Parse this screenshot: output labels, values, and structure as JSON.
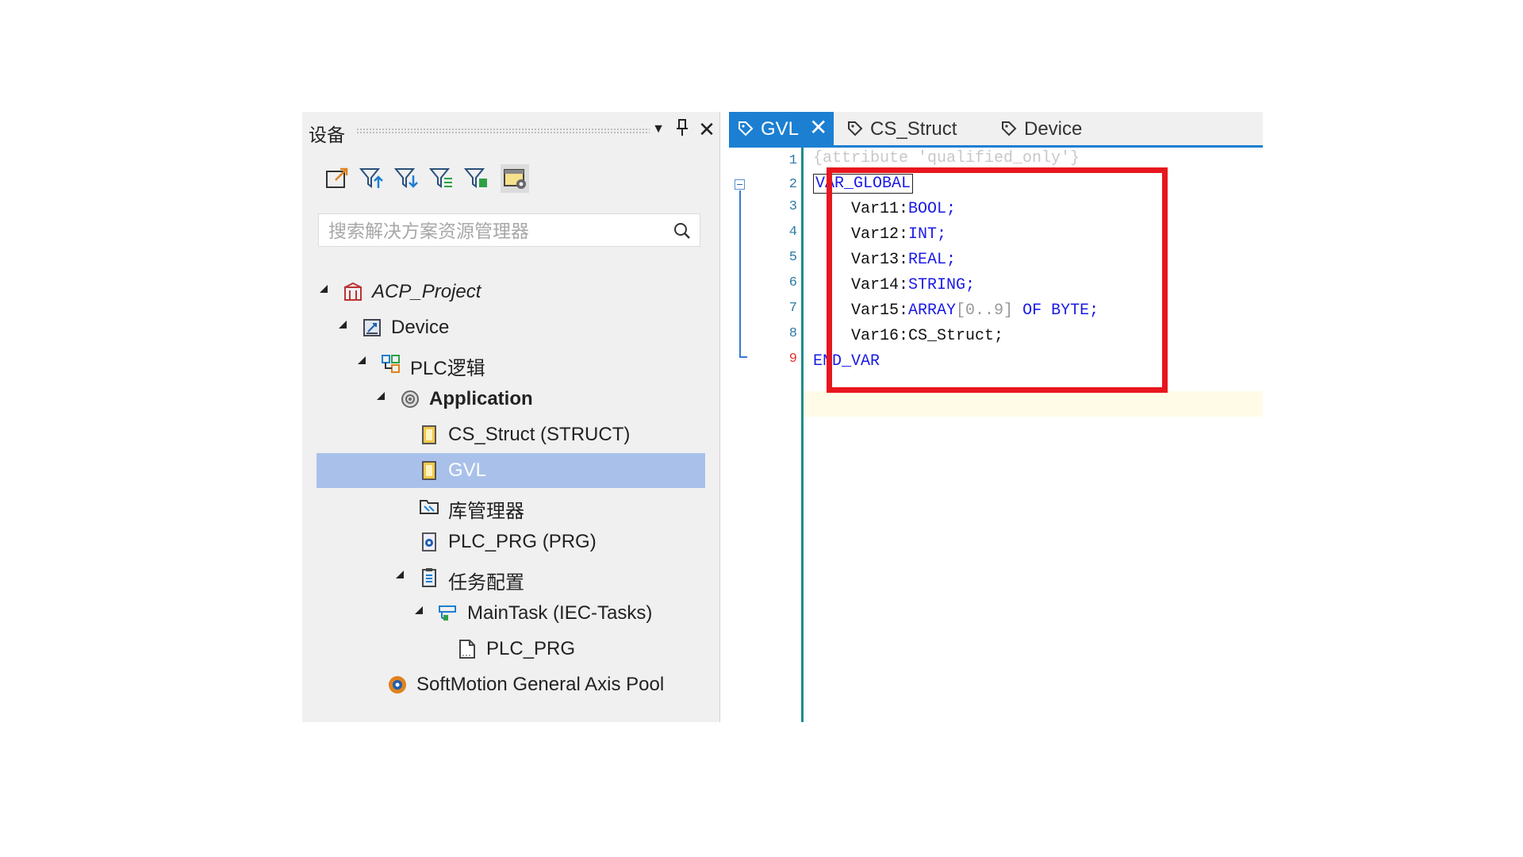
{
  "left_panel": {
    "title": "设备",
    "search_placeholder": "搜索解决方案资源管理器",
    "toolbar_icons": [
      "export-icon",
      "filter-up-icon",
      "filter-down-icon",
      "filter-list-icon",
      "filter-green-icon",
      "settings-panel-icon"
    ],
    "tree": [
      {
        "label": "ACP_Project",
        "style": "italic",
        "icon": "project-icon",
        "expanded": true
      },
      {
        "label": "Device",
        "icon": "device-icon",
        "expanded": true
      },
      {
        "label": "PLC逻辑",
        "icon": "plc-logic-icon",
        "expanded": true
      },
      {
        "label": "Application",
        "style": "bold",
        "icon": "application-icon",
        "expanded": true
      },
      {
        "label": "CS_Struct (STRUCT)",
        "icon": "struct-icon"
      },
      {
        "label": "GVL",
        "icon": "gvl-icon",
        "selected": true
      },
      {
        "label": "库管理器",
        "icon": "library-icon"
      },
      {
        "label": "PLC_PRG (PRG)",
        "icon": "program-icon"
      },
      {
        "label": "任务配置",
        "icon": "task-config-icon",
        "expanded": true
      },
      {
        "label": "MainTask (IEC-Tasks)",
        "icon": "task-icon",
        "expanded": true
      },
      {
        "label": "PLC_PRG",
        "icon": "call-icon"
      },
      {
        "label": "SoftMotion General Axis Pool",
        "icon": "axis-pool-icon"
      }
    ]
  },
  "editor": {
    "tabs": [
      {
        "label": "GVL",
        "active": true
      },
      {
        "label": "CS_Struct",
        "active": false
      },
      {
        "label": "Device",
        "active": false
      }
    ],
    "line_numbers": [
      "1",
      "2",
      "3",
      "4",
      "5",
      "6",
      "7",
      "8",
      "9"
    ],
    "active_line": "9",
    "code": {
      "l1": "{attribute 'qualified_only'}",
      "l2_kw": "VAR_GLOBAL",
      "l3_name": "Var11:",
      "l3_type": "BOOL;",
      "l4_name": "Var12:",
      "l4_type": "INT;",
      "l5_name": "Var13:",
      "l5_type": "REAL;",
      "l6_name": "Var14:",
      "l6_type": "STRING;",
      "l7_name": "Var15:",
      "l7_type": "ARRAY",
      "l7_range": "[0..9]",
      "l7_of": "OF",
      "l7_elem": "BYTE;",
      "l8_name": "Var16:",
      "l8_type": "CS_Struct;",
      "l9_kw": "END_VAR"
    }
  },
  "colors": {
    "accent": "#1c7fd1",
    "selection": "#a9c1ea",
    "keyword": "#1a1ae6",
    "highlight_box": "#e8161e"
  }
}
